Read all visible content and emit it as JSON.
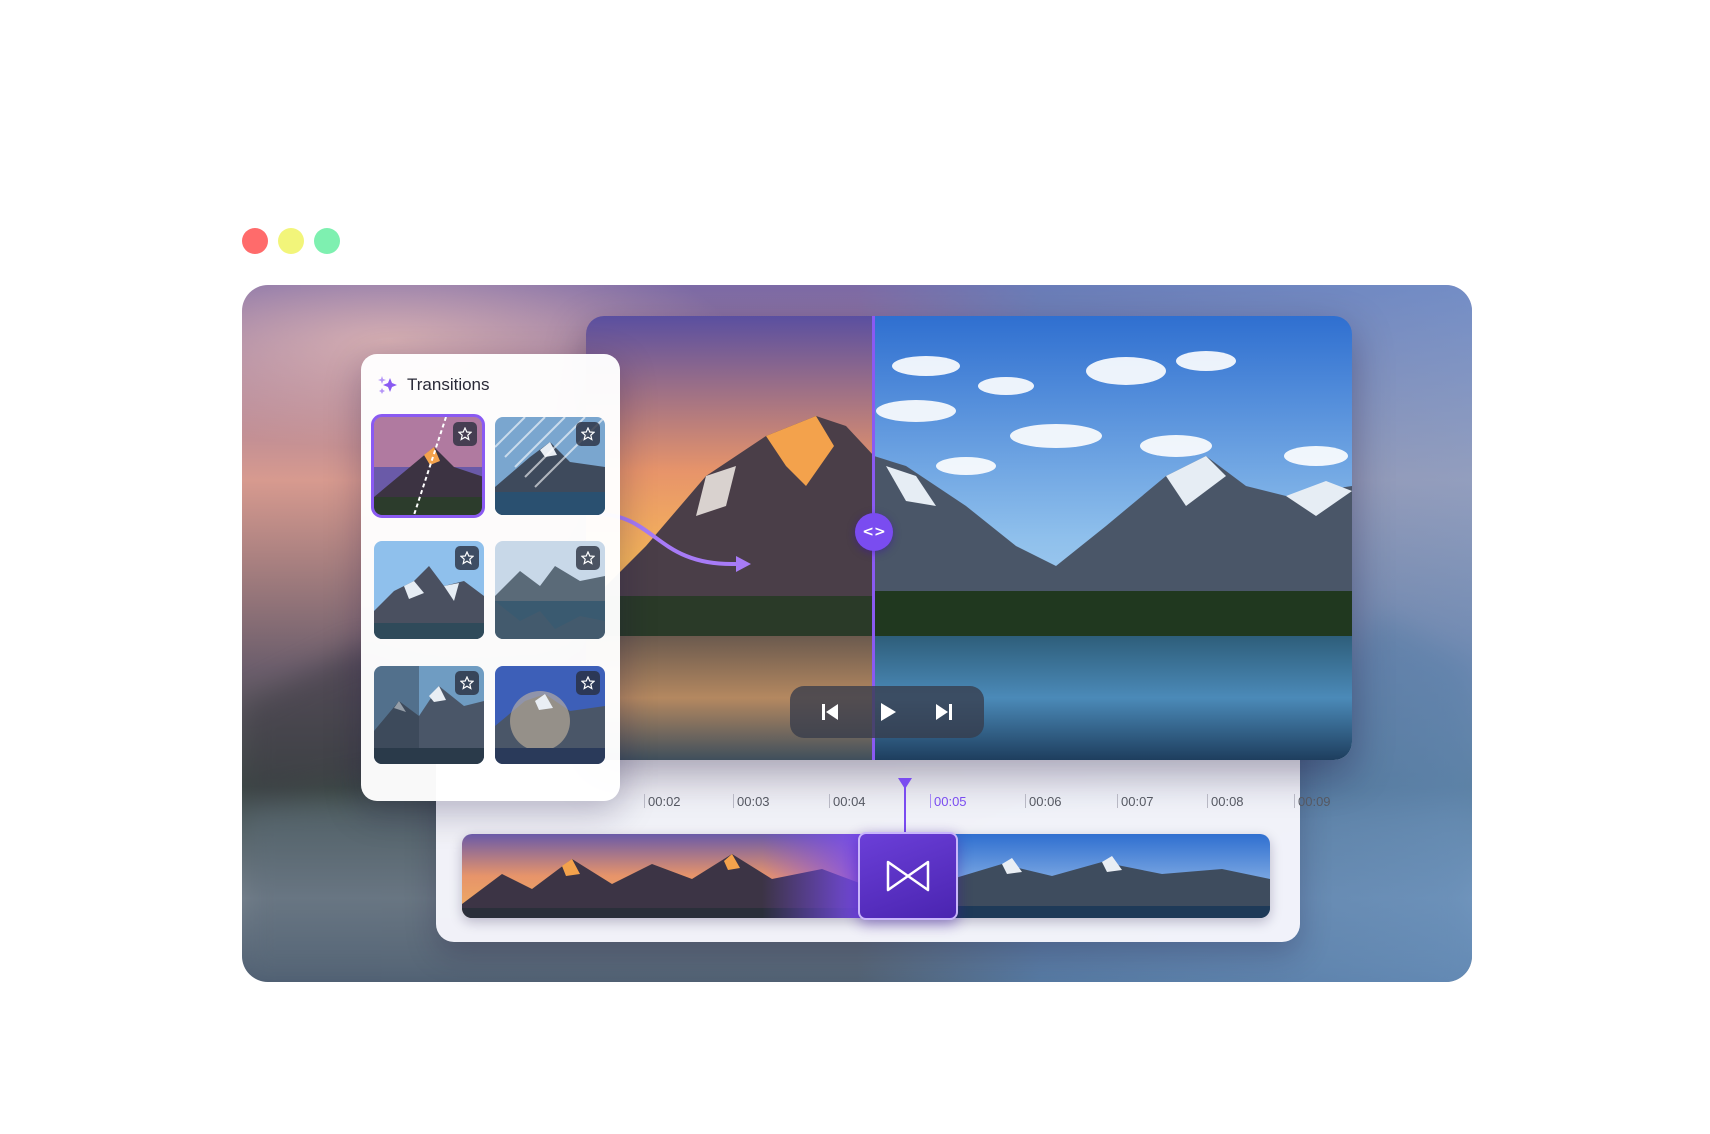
{
  "window_controls": [
    {
      "name": "close",
      "color": "#ff6b6b"
    },
    {
      "name": "minimize",
      "color": "#f2f57a"
    },
    {
      "name": "maximize",
      "color": "#7ef0b0"
    }
  ],
  "transitions_panel": {
    "title": "Transitions",
    "icon": "sparkles-icon",
    "items": [
      {
        "name": "diagonal-wipe",
        "selected": true,
        "star_icon": "star-icon"
      },
      {
        "name": "stripes-wipe",
        "selected": false,
        "star_icon": "star-icon"
      },
      {
        "name": "shatter",
        "selected": false,
        "star_icon": "star-icon"
      },
      {
        "name": "cross-dissolve",
        "selected": false,
        "star_icon": "star-icon"
      },
      {
        "name": "panel-slide",
        "selected": false,
        "star_icon": "star-icon"
      },
      {
        "name": "circle-reveal",
        "selected": false,
        "star_icon": "star-icon"
      }
    ]
  },
  "preview": {
    "split_handle_label": "<>",
    "controls": [
      "skip-back-icon",
      "play-icon",
      "skip-forward-icon"
    ]
  },
  "timeline": {
    "ticks": [
      "00:02",
      "00:03",
      "00:04",
      "00:05",
      "00:06",
      "00:07",
      "00:08",
      "00:09"
    ],
    "current": "00:05",
    "transition_icon": "bowtie-transition-icon"
  },
  "colors": {
    "accent": "#7a4cf0",
    "accent_dark": "#4a24b0"
  }
}
